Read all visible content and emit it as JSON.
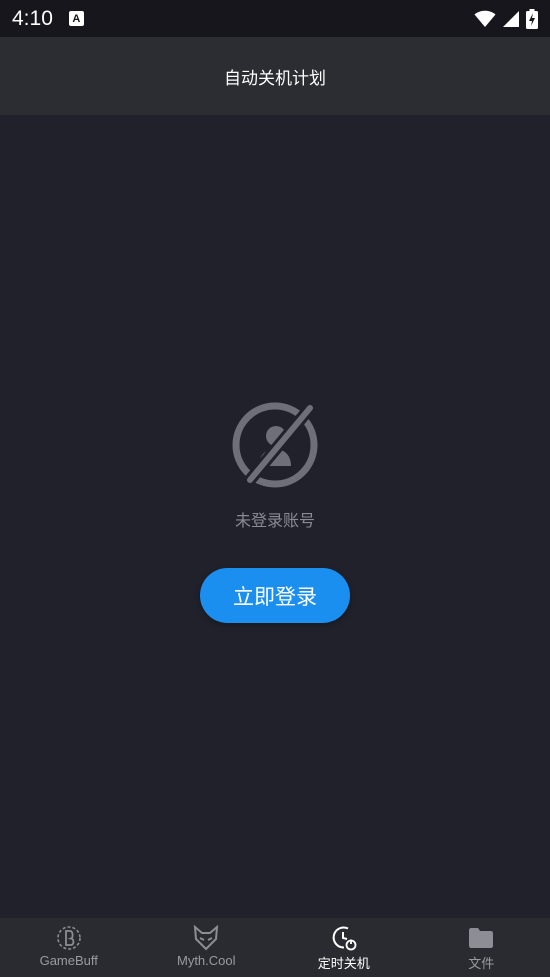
{
  "status_bar": {
    "time": "4:10",
    "notification_icon": "A",
    "icons": [
      "wifi-icon",
      "signal-icon",
      "battery-charging-icon"
    ]
  },
  "app_bar": {
    "title": "自动关机计划"
  },
  "empty_state": {
    "icon": "no-account-icon",
    "message": "未登录账号",
    "button_label": "立即登录"
  },
  "bottom_nav": {
    "items": [
      {
        "label": "GameBuff",
        "icon": "gamebuff-icon",
        "active": false
      },
      {
        "label": "Myth.Cool",
        "icon": "myth-cool-icon",
        "active": false
      },
      {
        "label": "定时关机",
        "icon": "timer-shutdown-icon",
        "active": true
      },
      {
        "label": "文件",
        "icon": "folder-icon",
        "active": false
      }
    ]
  },
  "colors": {
    "background": "#21212b",
    "app_bar": "#2c2d33",
    "accent": "#1b8ff0",
    "muted_text": "#8a8a94"
  }
}
